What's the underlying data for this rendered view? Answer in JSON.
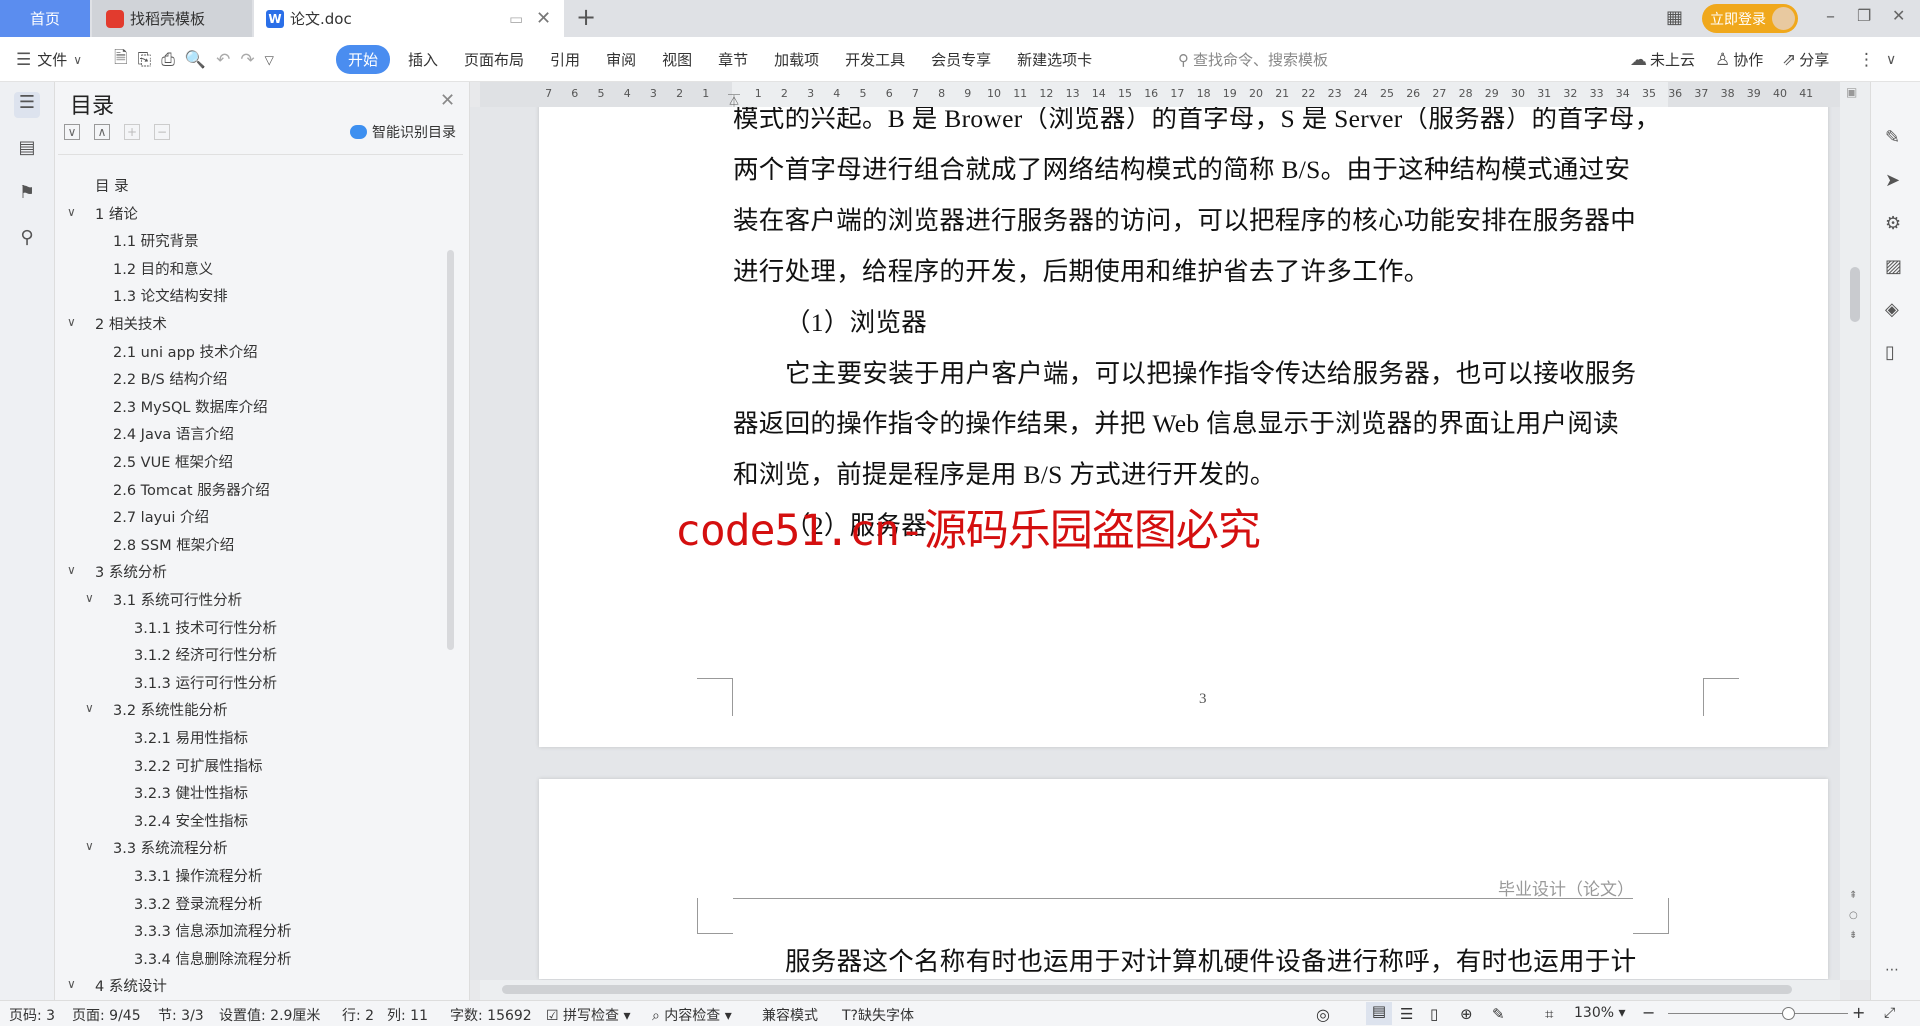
{
  "tabs": {
    "home": "首页",
    "template": "找稻壳模板",
    "document": "论文.doc",
    "new_tab": "+"
  },
  "window": {
    "login": "立即登录",
    "minimize": "–",
    "restore": "❐",
    "close": "✕"
  },
  "toolbar": {
    "file": "文件",
    "menus": [
      "开始",
      "插入",
      "页面布局",
      "引用",
      "审阅",
      "视图",
      "章节",
      "加载项",
      "开发工具",
      "会员专享",
      "新建选项卡"
    ],
    "active_menu": "开始",
    "search_placeholder": "查找命令、搜索模板",
    "cloud": "未上云",
    "collab": "协作",
    "share": "分享"
  },
  "toc": {
    "title": "目录",
    "smart": "智能识别目录",
    "items": [
      {
        "label": "目  录",
        "level": 0,
        "chevron": false
      },
      {
        "label": "1  绪论",
        "level": 1,
        "chevron": true
      },
      {
        "label": "1.1  研究背景",
        "level": 2,
        "chevron": false
      },
      {
        "label": "1.2  目的和意义",
        "level": 2,
        "chevron": false
      },
      {
        "label": "1.3  论文结构安排",
        "level": 2,
        "chevron": false
      },
      {
        "label": "2  相关技术",
        "level": 1,
        "chevron": true
      },
      {
        "label": "2.1 uni app 技术介绍",
        "level": 2,
        "chevron": false
      },
      {
        "label": "2.2 B/S 结构介绍",
        "level": 2,
        "chevron": false
      },
      {
        "label": "2.3 MySQL 数据库介绍",
        "level": 2,
        "chevron": false
      },
      {
        "label": "2.4 Java 语言介绍",
        "level": 2,
        "chevron": false
      },
      {
        "label": "2.5 VUE 框架介绍",
        "level": 2,
        "chevron": false
      },
      {
        "label": "2.6 Tomcat 服务器介绍",
        "level": 2,
        "chevron": false
      },
      {
        "label": "2.7 layui 介绍",
        "level": 2,
        "chevron": false
      },
      {
        "label": "2.8 SSM 框架介绍",
        "level": 2,
        "chevron": false
      },
      {
        "label": "3  系统分析",
        "level": 1,
        "chevron": true
      },
      {
        "label": "3.1  系统可行性分析",
        "level": 2,
        "chevron": true
      },
      {
        "label": "3.1.1  技术可行性分析",
        "level": 3,
        "chevron": false
      },
      {
        "label": "3.1.2  经济可行性分析",
        "level": 3,
        "chevron": false
      },
      {
        "label": "3.1.3  运行可行性分析",
        "level": 3,
        "chevron": false
      },
      {
        "label": "3.2  系统性能分析",
        "level": 2,
        "chevron": true
      },
      {
        "label": "3.2.1  易用性指标",
        "level": 3,
        "chevron": false
      },
      {
        "label": "3.2.2  可扩展性指标",
        "level": 3,
        "chevron": false
      },
      {
        "label": "3.2.3  健壮性指标",
        "level": 3,
        "chevron": false
      },
      {
        "label": "3.2.4  安全性指标",
        "level": 3,
        "chevron": false
      },
      {
        "label": "3.3  系统流程分析",
        "level": 2,
        "chevron": true
      },
      {
        "label": "3.3.1  操作流程分析",
        "level": 3,
        "chevron": false
      },
      {
        "label": "3.3.2  登录流程分析",
        "level": 3,
        "chevron": false
      },
      {
        "label": "3.3.3  信息添加流程分析",
        "level": 3,
        "chevron": false
      },
      {
        "label": "3.3.4  信息删除流程分析",
        "level": 3,
        "chevron": false
      },
      {
        "label": "4  系统设计",
        "level": 1,
        "chevron": true
      }
    ]
  },
  "ruler": {
    "left": [
      "7",
      "6",
      "5",
      "4",
      "3",
      "2",
      "1"
    ],
    "right": [
      "1",
      "2",
      "3",
      "4",
      "5",
      "6",
      "7",
      "8",
      "9",
      "10",
      "11",
      "12",
      "13",
      "14",
      "15",
      "16",
      "17",
      "18",
      "19",
      "20",
      "21",
      "22",
      "23",
      "24",
      "25",
      "26",
      "27",
      "28",
      "29",
      "30",
      "31",
      "32",
      "33",
      "34",
      "35",
      "36",
      "37",
      "38",
      "39",
      "40",
      "41"
    ]
  },
  "document": {
    "page1_lines": [
      "模式的兴起。B 是 Brower（浏览器）的首字母，S 是 Server（服务器）的首字母，",
      "两个首字母进行组合就成了网络结构模式的简称 B/S。由于这种结构模式通过安",
      "装在客户端的浏览器进行服务器的访问，可以把程序的核心功能安排在服务器中",
      "进行处理，给程序的开发，后期使用和维护省去了许多工作。",
      "（1）浏览器",
      "它主要安装于用户客户端，可以把操作指令传达给服务器，也可以接收服务",
      "器返回的操作指令的操作结果，并把 Web 信息显示于浏览器的界面让用户阅读",
      "和浏览，前提是程序是用 B/S 方式进行开发的。",
      "（2）服务器"
    ],
    "page_number": "3",
    "page2_header": "毕业设计（论文）",
    "page2_line": "服务器这个名称有时也运用于对计算机硬件设备进行称呼，有时也运用于计",
    "watermark": "code51.cn-源码乐园盗图必究"
  },
  "status": {
    "page_no": "页码: 3",
    "pages": "页面: 9/45",
    "section": "节: 3/3",
    "setting": "设置值: 2.9厘米",
    "row": "行: 2",
    "col": "列: 11",
    "words": "字数: 15692",
    "spell": "拼写检查",
    "content": "内容检查",
    "compat": "兼容模式",
    "missing_font": "缺失字体",
    "zoom": "130%",
    "zoom_level_percent": 130
  },
  "colors": {
    "accent": "#4a8df0",
    "login": "#f0a81c",
    "watermark": "#d40f0f"
  }
}
